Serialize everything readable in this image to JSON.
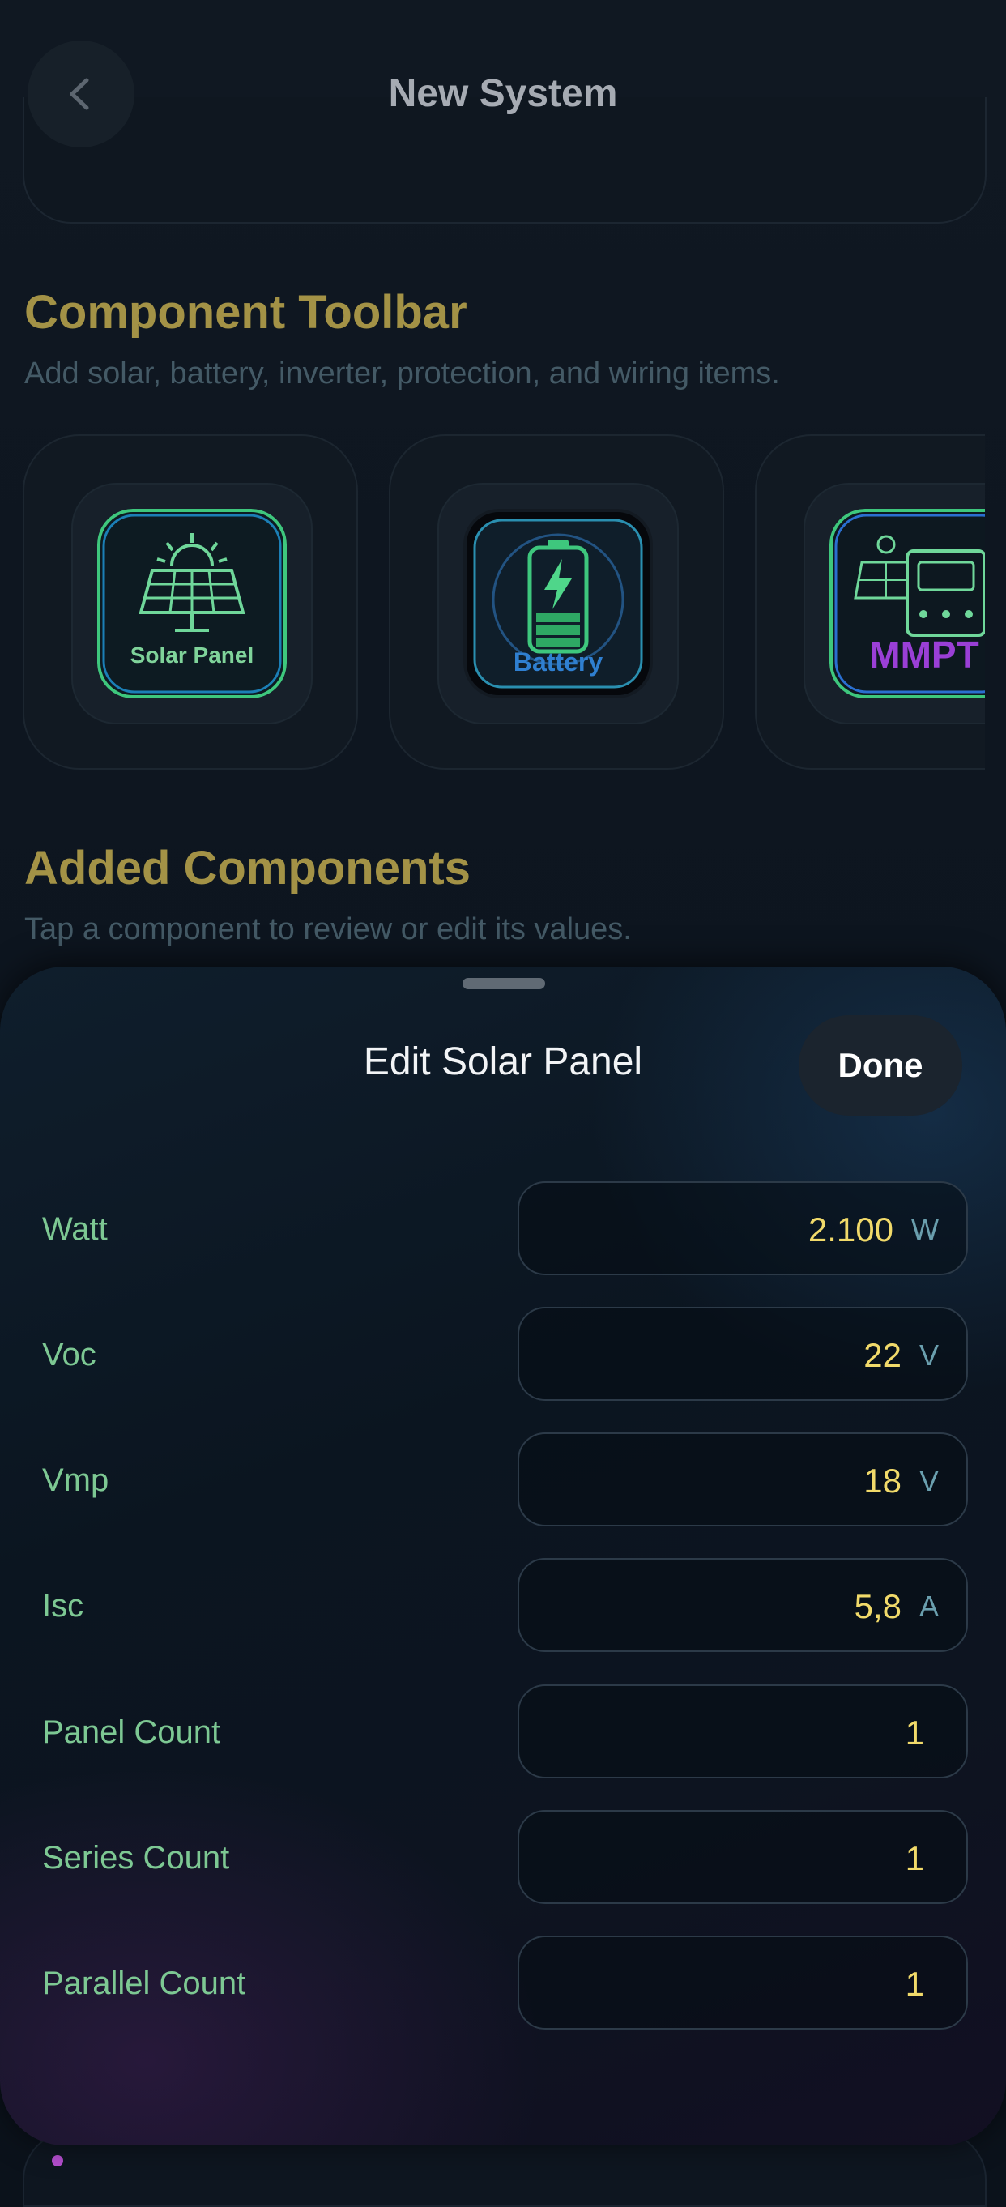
{
  "header": {
    "title": "New System",
    "back_icon": "chevron-left-icon"
  },
  "toolbar_section": {
    "title": "Component Toolbar",
    "subtitle": "Add solar, battery, inverter, protection, and wiring items.",
    "items": [
      {
        "label": "Solar Panel",
        "icon": "solar-panel-icon",
        "color": "#7fd39a"
      },
      {
        "label": "Battery",
        "icon": "battery-icon",
        "color": "#2f7fd0"
      },
      {
        "label": "MMPT",
        "icon": "mppt-controller-icon",
        "color": "#9a3fd6"
      }
    ]
  },
  "added_section": {
    "title": "Added Components",
    "subtitle": "Tap a component to review or edit its values."
  },
  "sheet": {
    "title": "Edit Solar Panel",
    "done_label": "Done",
    "fields": [
      {
        "label": "Watt",
        "value": "2.100",
        "unit": "W"
      },
      {
        "label": "Voc",
        "value": "22",
        "unit": "V"
      },
      {
        "label": "Vmp",
        "value": "18",
        "unit": "V"
      },
      {
        "label": "Isc",
        "value": "5,8",
        "unit": "A"
      },
      {
        "label": "Panel Count",
        "value": "1",
        "unit": ""
      },
      {
        "label": "Series Count",
        "value": "1",
        "unit": ""
      },
      {
        "label": "Parallel Count",
        "value": "1",
        "unit": ""
      }
    ]
  },
  "colors": {
    "accent_title": "#a39246",
    "field_label": "#7dc893",
    "field_value": "#f1da6a"
  }
}
